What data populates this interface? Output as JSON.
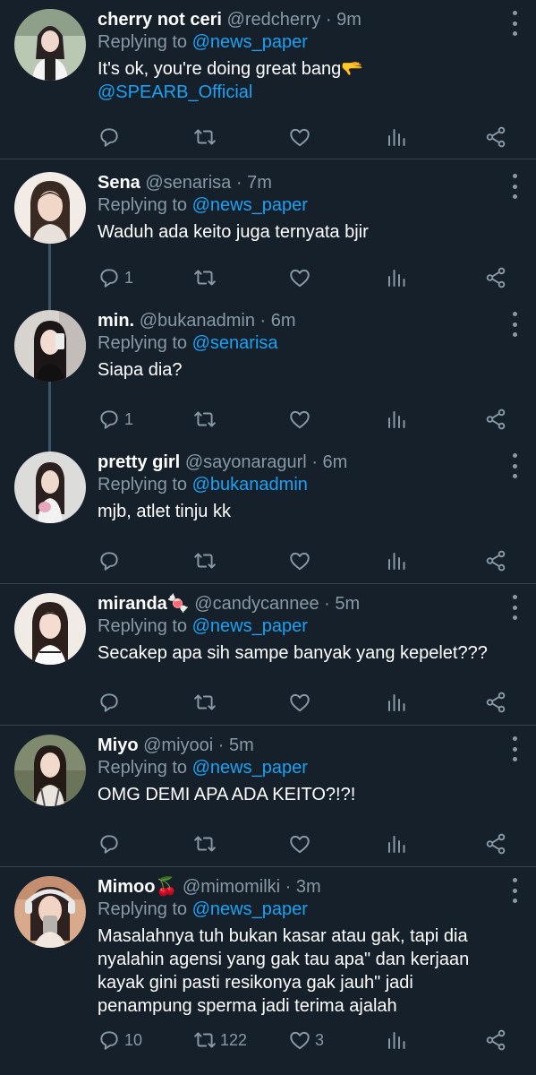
{
  "tweets": [
    {
      "name": "cherry not ceri",
      "name_emoji": "",
      "handle": "@redcherry",
      "time": "9m",
      "replying_to_label": "Replying to",
      "replying_to": "@news_paper",
      "text": "It's ok, you're doing great bang🫳",
      "mention_line": "@SPEARB_Official",
      "reply_count": "",
      "retweet_count": "",
      "like_count": ""
    },
    {
      "name": "Sena",
      "name_emoji": "",
      "handle": "@senarisa",
      "time": "7m",
      "replying_to_label": "Replying to",
      "replying_to": "@news_paper",
      "text": "Waduh ada keito juga ternyata bjir",
      "reply_count": "1",
      "retweet_count": "",
      "like_count": ""
    },
    {
      "name": "min.",
      "name_emoji": "",
      "handle": "@bukanadmin",
      "time": "6m",
      "replying_to_label": "Replying to",
      "replying_to": "@senarisa",
      "text": "Siapa dia?",
      "reply_count": "1",
      "retweet_count": "",
      "like_count": ""
    },
    {
      "name": "pretty girl",
      "name_emoji": "",
      "handle": "@sayonaragurl",
      "time": "6m",
      "replying_to_label": "Replying to",
      "replying_to": "@bukanadmin",
      "text": "mjb, atlet tinju kk",
      "reply_count": "",
      "retweet_count": "",
      "like_count": ""
    },
    {
      "name": "miranda",
      "name_emoji": "🍬",
      "handle": "@candycannee",
      "time": "5m",
      "replying_to_label": "Replying to",
      "replying_to": "@news_paper",
      "text": "Secakep apa sih sampe banyak yang kepelet???",
      "reply_count": "",
      "retweet_count": "",
      "like_count": ""
    },
    {
      "name": "Miyo",
      "name_emoji": "",
      "handle": "@miyooi",
      "time": "5m",
      "replying_to_label": "Replying to",
      "replying_to": "@news_paper",
      "text": "OMG DEMI APA ADA KEITO?!?!",
      "reply_count": "",
      "retweet_count": "",
      "like_count": ""
    },
    {
      "name": "Mimoo",
      "name_emoji": "🍒",
      "handle": "@mimomilki",
      "time": "3m",
      "replying_to_label": "Replying to",
      "replying_to": "@news_paper",
      "text": "Masalahnya tuh bukan kasar atau gak, tapi dia nyalahin agensi yang gak tau apa\" dan kerjaan kayak gini pasti resikonya gak jauh\" jadi penampung sperma jadi terima ajalah",
      "reply_count": "10",
      "retweet_count": "122",
      "like_count": "3"
    }
  ],
  "separator": "·",
  "colors": {
    "background": "#15202b",
    "text": "#ffffff",
    "secondary": "#8899a6",
    "mention": "#1da1f2",
    "divider": "#38444d",
    "thread_line": "#3d5466"
  },
  "icons": [
    "reply-icon",
    "retweet-icon",
    "like-icon",
    "stats-icon",
    "share-icon",
    "more-options-icon"
  ]
}
